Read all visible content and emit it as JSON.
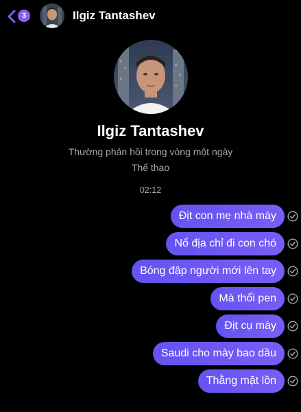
{
  "header": {
    "back_icon": "chevron-left-icon",
    "unread_badge": "3",
    "contact_name": "Ilgiz Tantashev"
  },
  "profile": {
    "name": "Ilgiz Tantashev",
    "response_time": "Thường phản hồi trong vòng một ngày",
    "category": "Thể thao"
  },
  "conversation": {
    "timestamp": "02:12",
    "messages": [
      {
        "text": "Địt con mẹ nhà mày",
        "status": "sent"
      },
      {
        "text": "Nổ địa chỉ đi con chó",
        "status": "sent"
      },
      {
        "text": "Bóng đập người mới lên tay",
        "status": "sent"
      },
      {
        "text": "Mà thổi pen",
        "status": "sent"
      },
      {
        "text": "Địt cụ mày",
        "status": "sent"
      },
      {
        "text": "Saudi cho mày bao dầu",
        "status": "sent"
      },
      {
        "text": "Thằng mặt lồn",
        "status": "sent"
      }
    ]
  },
  "colors": {
    "background": "#000000",
    "bubble": "#6f5cf6",
    "badge": "#8d5cf5",
    "secondary_text": "#a8a8a8"
  }
}
